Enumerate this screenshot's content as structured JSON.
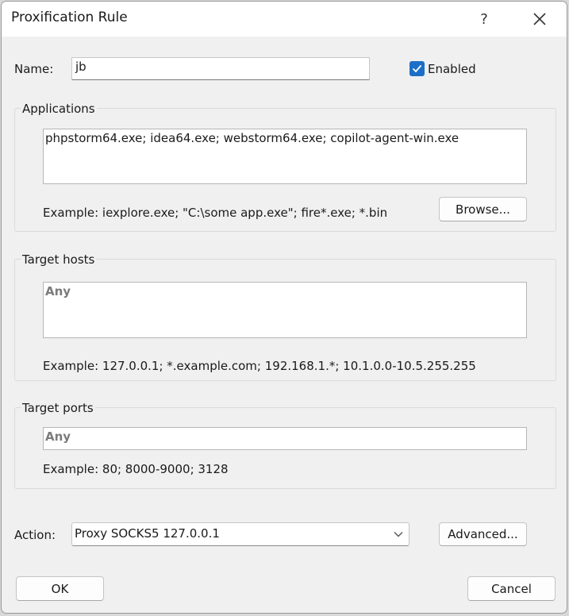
{
  "window": {
    "title": "Proxification Rule",
    "help_glyph": "?"
  },
  "name": {
    "label": "Name:",
    "value": "jb"
  },
  "enabled": {
    "label": "Enabled",
    "checked": true
  },
  "applications": {
    "group_label": "Applications",
    "value": "phpstorm64.exe; idea64.exe; webstorm64.exe; copilot-agent-win.exe",
    "example": "Example: iexplore.exe; \"C:\\some app.exe\"; fire*.exe; *.bin",
    "browse_label": "Browse..."
  },
  "target_hosts": {
    "group_label": "Target hosts",
    "value": "Any",
    "example": "Example: 127.0.0.1; *.example.com; 192.168.1.*; 10.1.0.0-10.5.255.255"
  },
  "target_ports": {
    "group_label": "Target ports",
    "value": "Any",
    "example": "Example: 80; 8000-9000; 3128"
  },
  "action": {
    "label": "Action:",
    "selected": "Proxy SOCKS5 127.0.0.1",
    "advanced_label": "Advanced..."
  },
  "footer": {
    "ok_label": "OK",
    "cancel_label": "Cancel"
  },
  "colors": {
    "accent": "#1c6fc6",
    "placeholder": "#7b7b7b",
    "dialog_bg": "#f0f0f0"
  }
}
